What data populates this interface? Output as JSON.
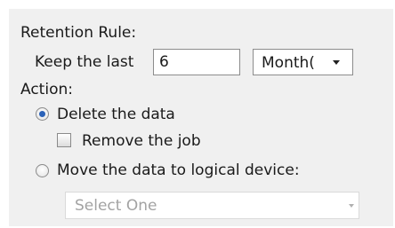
{
  "retention": {
    "heading": "Retention Rule:",
    "keep_label": "Keep the last",
    "keep_value": "6",
    "unit_selected": "Month("
  },
  "action": {
    "heading": "Action:",
    "delete_label": "Delete the data",
    "delete_selected": true,
    "remove_job_label": "Remove the job",
    "remove_job_checked": false,
    "move_label": "Move the data to logical device:",
    "move_selected": false,
    "device_select_placeholder": "Select One"
  },
  "icons": {
    "unit_dropdown": "chevron-down-icon",
    "device_dropdown": "chevron-down-icon"
  },
  "colors": {
    "panel_background": "#f0f0f0",
    "radio_selected": "#2b62b8",
    "disabled_text": "#a3a3a3"
  }
}
